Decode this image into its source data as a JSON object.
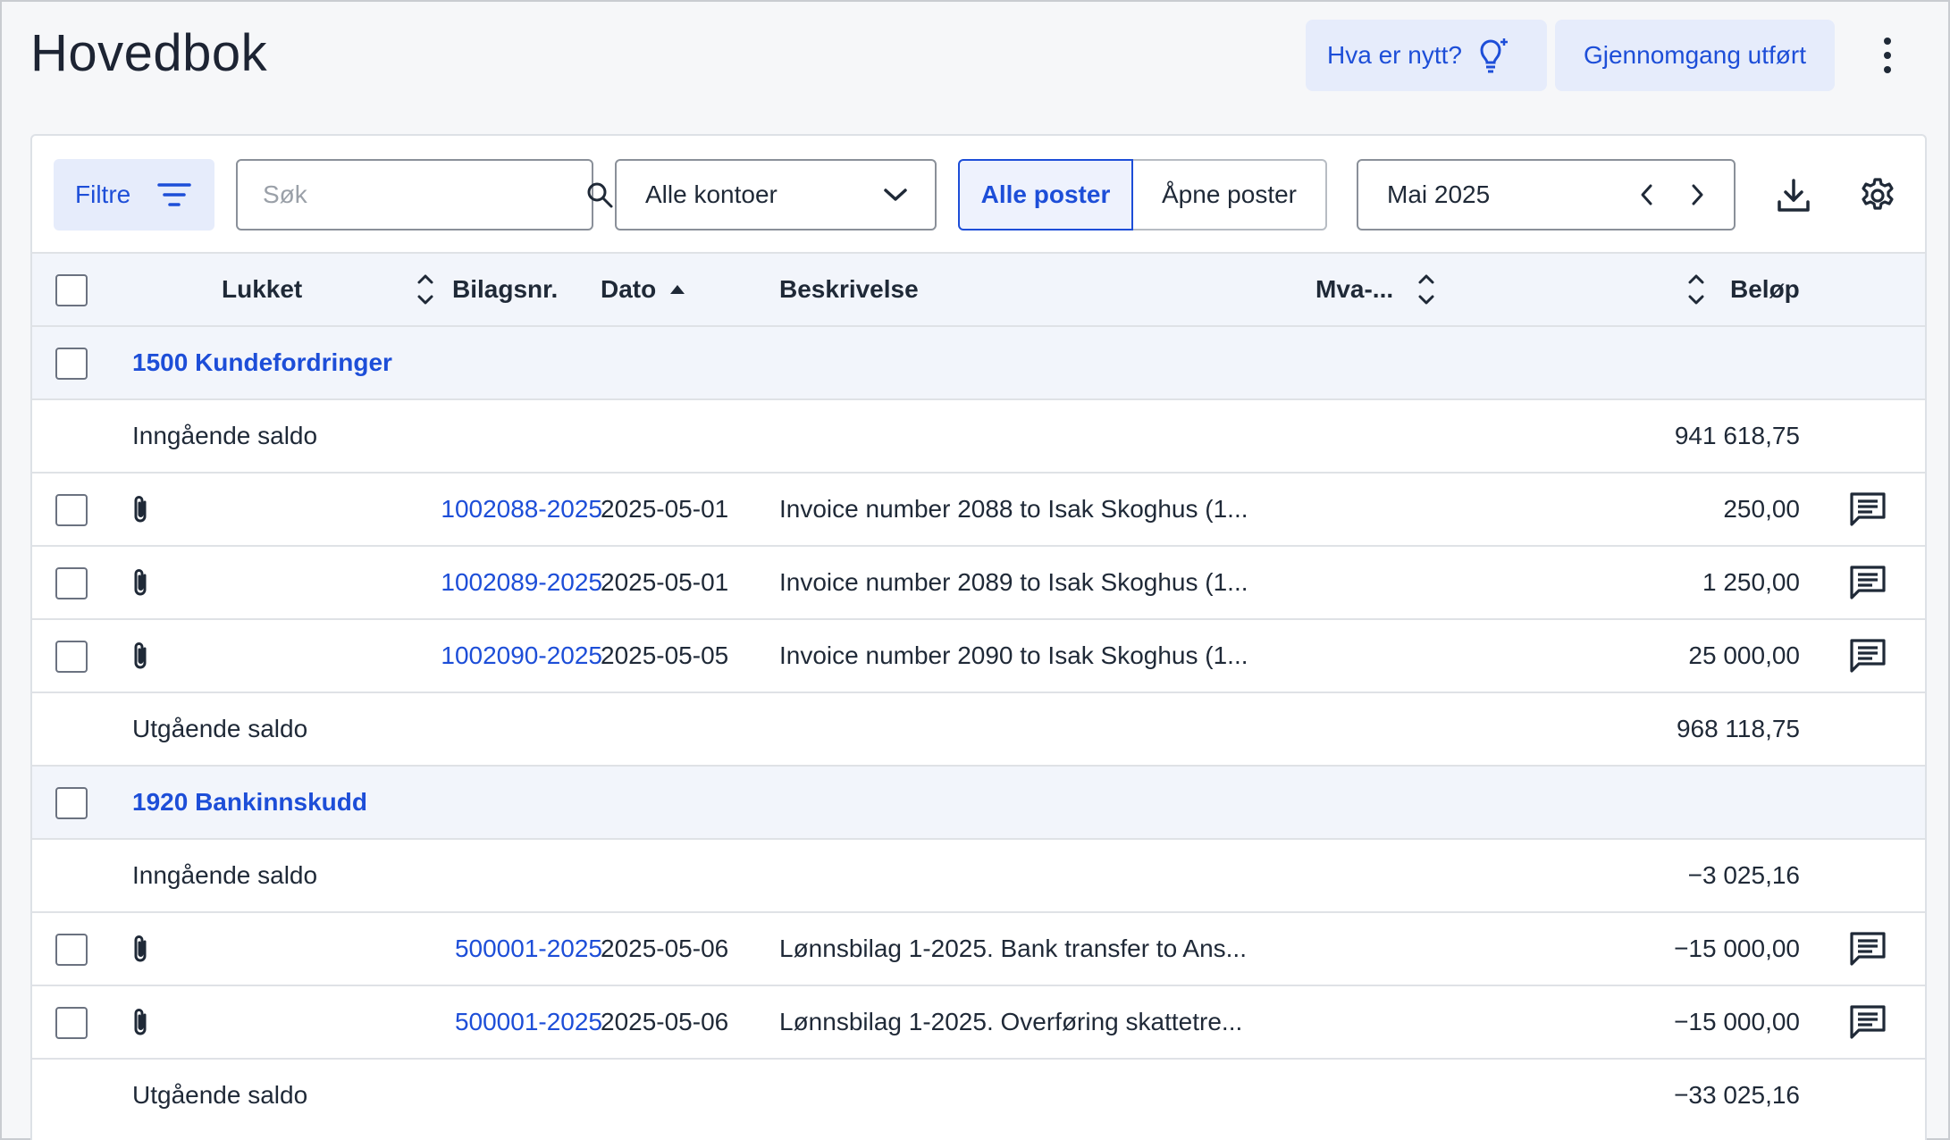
{
  "header": {
    "title": "Hovedbok",
    "whats_new_label": "Hva er nytt?",
    "review_label": "Gjennomgang utført"
  },
  "toolbar": {
    "filter_label": "Filtre",
    "search_placeholder": "Søk",
    "account_select_value": "Alle kontoer",
    "segment_all": "Alle poster",
    "segment_open": "Åpne poster",
    "period_value": "Mai 2025"
  },
  "columns": {
    "lukket": "Lukket",
    "bilagsnr": "Bilagsnr.",
    "dato": "Dato",
    "beskrivelse": "Beskrivelse",
    "mva": "Mva-...",
    "belop": "Beløp"
  },
  "groups": [
    {
      "title": "1500 Kundefordringer",
      "opening_label": "Inngående saldo",
      "opening_amount": "941 618,75",
      "entries": [
        {
          "bilag": "1002088-2025",
          "dato": "2025-05-01",
          "beskrivelse": "Invoice number 2088 to Isak Skoghus (1...",
          "belop": "250,00"
        },
        {
          "bilag": "1002089-2025",
          "dato": "2025-05-01",
          "beskrivelse": "Invoice number 2089 to Isak Skoghus (1...",
          "belop": "1 250,00"
        },
        {
          "bilag": "1002090-2025",
          "dato": "2025-05-05",
          "beskrivelse": "Invoice number 2090 to Isak Skoghus (1...",
          "belop": "25 000,00"
        }
      ],
      "closing_label": "Utgående saldo",
      "closing_amount": "968 118,75"
    },
    {
      "title": "1920 Bankinnskudd",
      "opening_label": "Inngående saldo",
      "opening_amount": "−3 025,16",
      "entries": [
        {
          "bilag": "500001-2025",
          "dato": "2025-05-06",
          "beskrivelse": "Lønnsbilag 1-2025. Bank transfer to Ans...",
          "belop": "−15 000,00"
        },
        {
          "bilag": "500001-2025",
          "dato": "2025-05-06",
          "beskrivelse": "Lønnsbilag 1-2025. Overføring skattetre...",
          "belop": "−15 000,00"
        }
      ],
      "closing_label": "Utgående saldo",
      "closing_amount": "−33 025,16"
    }
  ],
  "icons": {
    "whats_new": "lightbulb-sparkle-icon",
    "filter": "filter-lines-icon",
    "search": "magnifier-icon",
    "dropdown": "chevron-down-icon",
    "prev": "chevron-left-icon",
    "next": "chevron-right-icon",
    "download": "download-icon",
    "settings": "gear-icon",
    "attachment": "paperclip-icon",
    "comment": "comment-icon",
    "more": "kebab-icon"
  },
  "colors": {
    "accent": "#1d4ed8",
    "accent_bg": "#e6ecfb",
    "header_row_bg": "#f2f5fb"
  }
}
